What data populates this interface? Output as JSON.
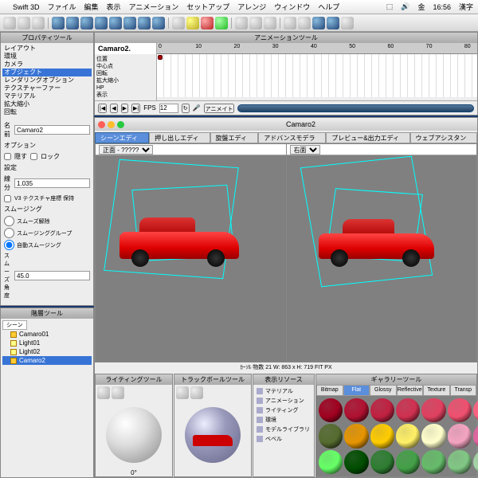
{
  "menubar": {
    "app": "Swift 3D",
    "items": [
      "ファイル",
      "編集",
      "表示",
      "アニメーション",
      "セットアップ",
      "アレンジ",
      "ウィンドウ",
      "ヘルプ"
    ],
    "day": "金",
    "time": "16:56",
    "ime": "漢字"
  },
  "property_panel": {
    "title": "プロパティツール",
    "items": [
      "レイアウト",
      "環境",
      "カメラ",
      "オブジェクト",
      "レンダリングオプション",
      "テクスチャーファー",
      "マテリアル",
      "拡大縮小",
      "回転"
    ],
    "selected_index": 3,
    "name_label": "名前",
    "name_value": "Camaro2",
    "options_label": "オプション",
    "hide_label": "隠す",
    "lock_label": "ロック",
    "settings_label": "設定",
    "segments_label": "線分",
    "segments_value": "1.035",
    "v3tex_label": "V3 テクスチャ座標 保持",
    "smooth_title": "スムージング",
    "smooth_off": "スムーズ解除",
    "smooth_group": "スムージンググループ",
    "smooth_auto": "自動スムージング",
    "smooth_angle_label": "スムーズ角度",
    "smooth_angle_value": "45.0"
  },
  "scene_panel": {
    "title": "階層ツール",
    "tab": "シーン",
    "items": [
      "Camaro01",
      "Light01",
      "Light02",
      "Camaro2"
    ],
    "selected_index": 3
  },
  "animation": {
    "title": "アニメーションツール",
    "object": "Camaro2.",
    "props": [
      "位置",
      "中心点",
      "回転",
      "拡大縮小",
      "HP",
      "表示"
    ],
    "ruler": [
      "0",
      "10",
      "20",
      "30",
      "40",
      "50",
      "60",
      "70",
      "80"
    ],
    "fps_label": "FPS",
    "fps_value": "12",
    "animate_btn": "アニメイト"
  },
  "editor": {
    "title": "Camaro2",
    "tabs": [
      "シーンエディタ",
      "押し出しエディタ",
      "旋盤エディタ",
      "アドバンスモデラー",
      "プレビュー&出力エディタ",
      "ウェブアシスタント"
    ],
    "active_tab": 0,
    "view_left": "正面 - ?????",
    "view_right": "右面",
    "status": "ｶｰｿﾙ         物数  21      W: 863 x H: 719      FIT        PX"
  },
  "bottom": {
    "lighting_title": "ライティングツール",
    "trackball_title": "トラックボールツール",
    "angle": "0°",
    "cat_title": "表示リソース",
    "cats": [
      "マテリアル",
      "アニメーション",
      "ライティング",
      "環境",
      "モデルライブラリ",
      "ベベル"
    ],
    "gallery_title": "ギャラリーツール",
    "gal_tabs": [
      "Bitmap",
      "Flat",
      "Glossy",
      "Reflective",
      "Texture",
      "Transp"
    ],
    "gal_active": 1,
    "swatches": [
      "#a00020",
      "#b01030",
      "#c02040",
      "#d03050",
      "#e04060",
      "#f05070",
      "#ff6080",
      "#556b2f",
      "#e69500",
      "#ffcc00",
      "#fff066",
      "#ffffcc",
      "#f4a4c0",
      "#e464a0",
      "#66ff66",
      "#004d00",
      "#2e7d32",
      "#43a047",
      "#66bb6a",
      "#81c784",
      "#a5d6a7"
    ]
  }
}
